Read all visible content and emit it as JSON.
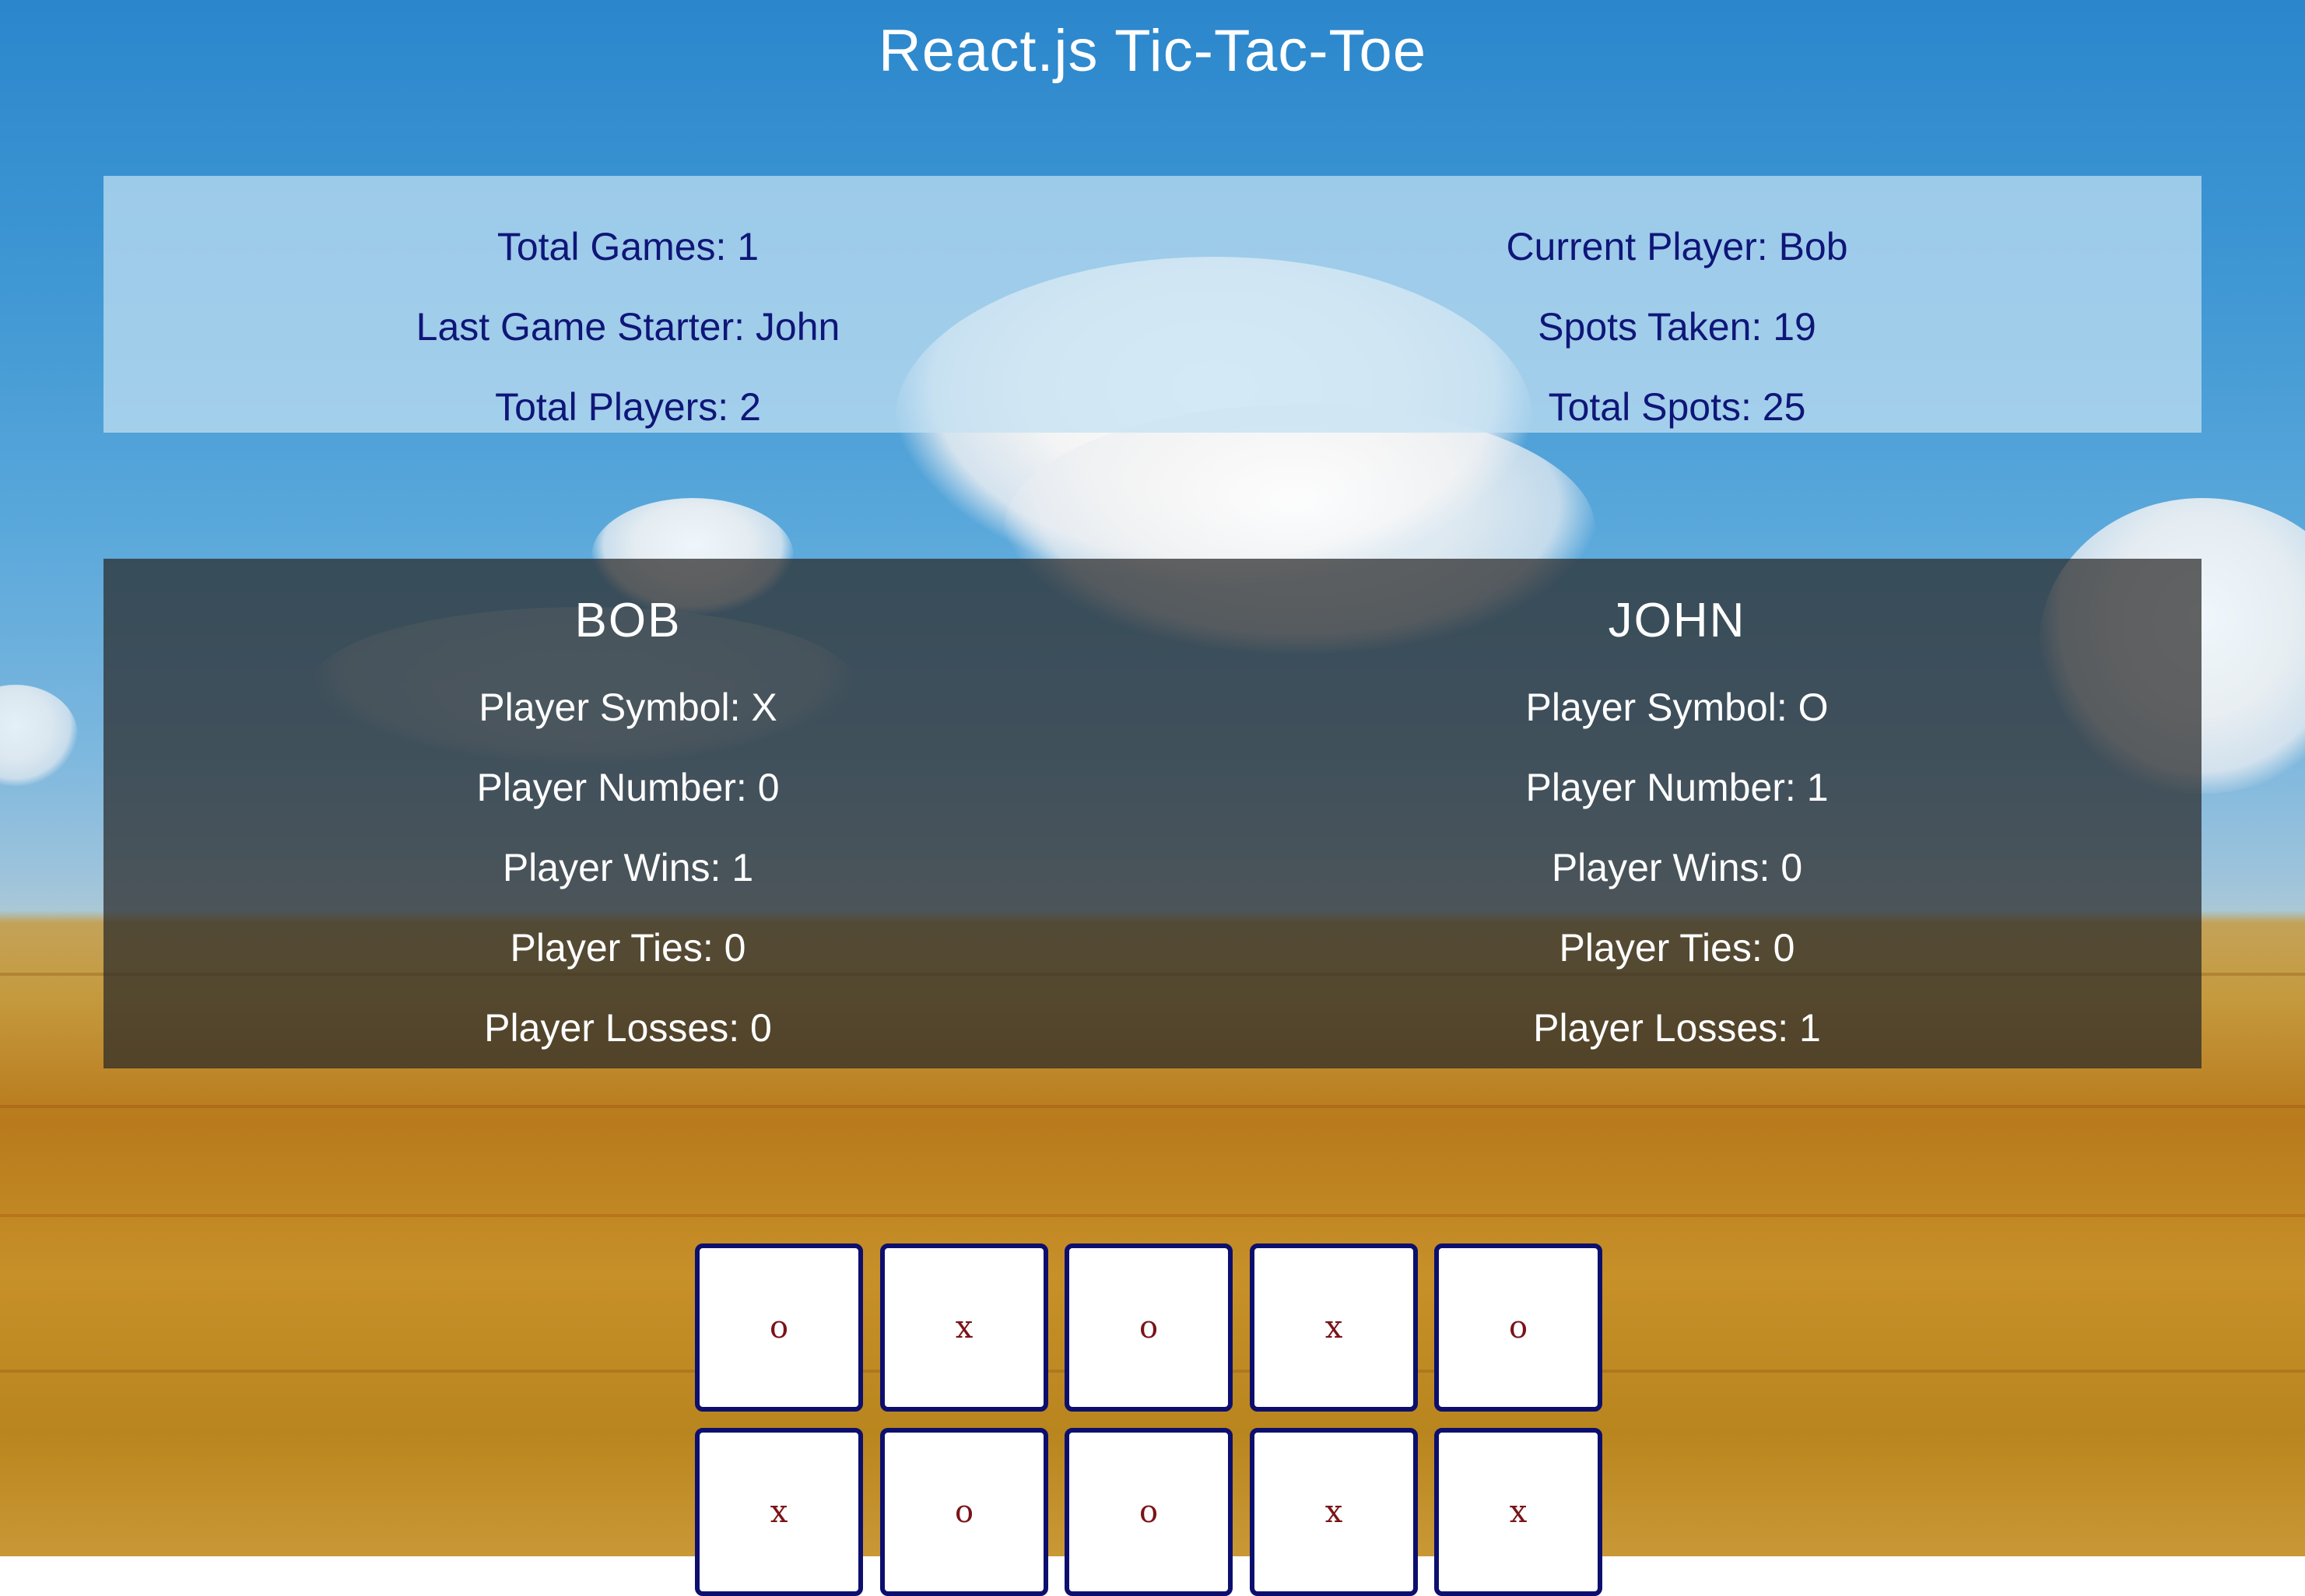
{
  "title": "React.js Tic-Tac-Toe",
  "stats": {
    "total_games": "Total Games: 1",
    "last_game_starter": "Last Game Starter: John",
    "total_players": "Total Players: 2",
    "current_player": "Current Player: Bob",
    "spots_taken": "Spots Taken: 19",
    "total_spots": "Total Spots: 25"
  },
  "players": [
    {
      "name": "BOB",
      "symbol": "Player Symbol: X",
      "number": "Player Number: 0",
      "wins": "Player Wins: 1",
      "ties": "Player Ties: 0",
      "losses": "Player Losses: 0"
    },
    {
      "name": "JOHN",
      "symbol": "Player Symbol: O",
      "number": "Player Number: 1",
      "wins": "Player Wins: 0",
      "ties": "Player Ties: 0",
      "losses": "Player Losses: 1"
    }
  ],
  "board": {
    "rows": [
      [
        "o",
        "x",
        "o",
        "x",
        "o"
      ],
      [
        "x",
        "o",
        "o",
        "x",
        "x"
      ]
    ]
  },
  "colors": {
    "stat_text": "#0f1678",
    "cell_border": "#0d0f6e",
    "cell_mark": "#7a1418"
  }
}
